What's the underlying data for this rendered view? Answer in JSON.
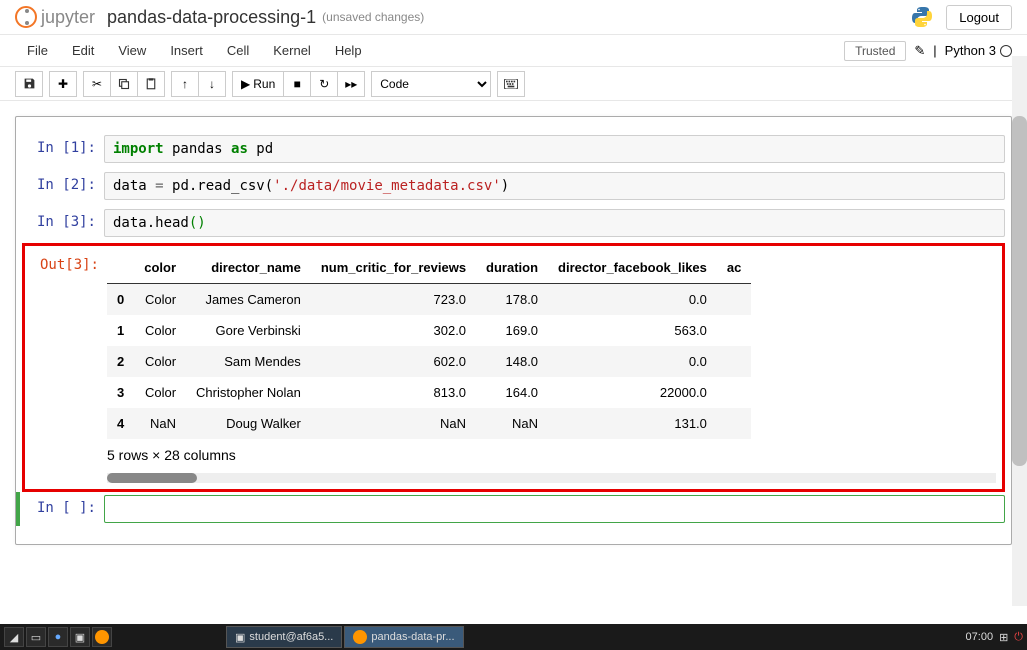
{
  "header": {
    "logo_text": "jupyter",
    "notebook_title": "pandas-data-processing-1",
    "save_status": "(unsaved changes)",
    "logout": "Logout"
  },
  "menubar": {
    "items": [
      "File",
      "Edit",
      "View",
      "Insert",
      "Cell",
      "Kernel",
      "Help"
    ],
    "trusted": "Trusted",
    "kernel_name": "Python 3"
  },
  "toolbar": {
    "run_label": "Run",
    "cell_type": "Code"
  },
  "cells": [
    {
      "prompt": "In [1]:"
    },
    {
      "prompt": "In [2]:"
    },
    {
      "prompt": "In [3]:"
    },
    {
      "out_prompt": "Out[3]:"
    },
    {
      "prompt": "In [ ]:"
    }
  ],
  "code": {
    "c1_import": "import",
    "c1_pandas": " pandas ",
    "c1_as": "as",
    "c1_pd": " pd",
    "c2_pre": "data ",
    "c2_eq": "=",
    "c2_call": " pd.read_csv(",
    "c2_str": "'./data/movie_metadata.csv'",
    "c2_close": ")",
    "c3_pre": "data.head",
    "c3_paren": "()"
  },
  "dataframe": {
    "columns": [
      "",
      "color",
      "director_name",
      "num_critic_for_reviews",
      "duration",
      "director_facebook_likes",
      "ac"
    ],
    "rows": [
      {
        "idx": "0",
        "color": "Color",
        "director": "James Cameron",
        "critics": "723.0",
        "duration": "178.0",
        "dfl": "0.0"
      },
      {
        "idx": "1",
        "color": "Color",
        "director": "Gore Verbinski",
        "critics": "302.0",
        "duration": "169.0",
        "dfl": "563.0"
      },
      {
        "idx": "2",
        "color": "Color",
        "director": "Sam Mendes",
        "critics": "602.0",
        "duration": "148.0",
        "dfl": "0.0"
      },
      {
        "idx": "3",
        "color": "Color",
        "director": "Christopher Nolan",
        "critics": "813.0",
        "duration": "164.0",
        "dfl": "22000.0"
      },
      {
        "idx": "4",
        "color": "NaN",
        "director": "Doug Walker",
        "critics": "NaN",
        "duration": "NaN",
        "dfl": "131.0"
      }
    ],
    "summary": "5 rows × 28 columns"
  },
  "taskbar": {
    "app1": "student@af6a5...",
    "app2": "pandas-data-pr...",
    "clock": "07:00"
  }
}
